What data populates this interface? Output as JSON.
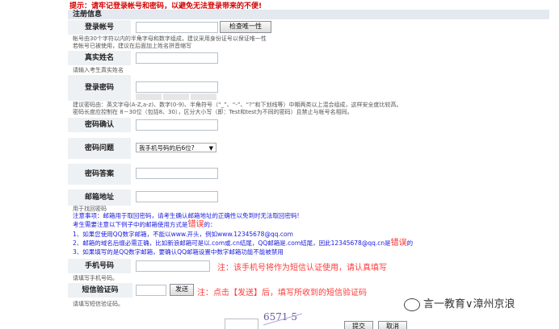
{
  "top_warning": "提示：请牢记登录帐号和密码，以避免无法登录带来的不便!",
  "section_title": "注册信息",
  "fields": {
    "account_label": "登录帐号",
    "check_button": "检查唯一性",
    "account_hint_1": "帐号由30个字符以内的半角字母和数字组成，建议采用身份证号以保证唯一性",
    "account_hint_2": "若帐号已被使用，建议在后面加上姓名拼音缩写",
    "realname_label": "真实姓名",
    "realname_hint": "请输入考生真实姓名",
    "password_label": "登录密码",
    "password_hint_1": "建议密码由：英文字母(A-Z,a-z)、数字(0-9)、半角符号（“_”、“-”、“?”和下划线等）中期两类以上混合组成，这样安全度比较高。",
    "password_hint_2": "密码长度应控制在 8－30位（包括8、30），区分大小写（即：Test和test为不同的密码）且禁止与帐号名相同。",
    "confirm_label": "密码确认",
    "question_label": "密码问题",
    "question_value": "我手机号码的后6位?",
    "answer_label": "密码答案",
    "email_label": "邮箱地址",
    "email_hint": "用于找回密码",
    "phone_label": "手机号码",
    "phone_note": "注：该手机号将作为短信认证使用，请认真填写",
    "phone_hint": "请填写手机号码。",
    "sms_label": "短信验证码",
    "send_button": "发送",
    "sms_note": "注：点击【发送】后，填写所收到的短信验证码",
    "sms_hint": "请填写短信验证码。",
    "submit_button": "提交",
    "cancel_button": "取消",
    "captcha_text": "6571 5"
  },
  "notice": {
    "line1": "注意事项：邮箱用于取回密码，请考生确认邮箱地址的正确性以免到时无法取回密码!",
    "line2_prefix": "考生需要注意以下例子中的邮箱使用方式是",
    "line2_error": "错误",
    "line2_suffix": "的：",
    "line3": "1、如果您使用QQ数字邮箱，不能以www.开头，例如www.12345678@qq.com",
    "line4_a": "2、邮箱的域名后缀必需正确，比如新浪邮箱可是以.com或.cn结尾，QQ邮箱是.com结尾，因此12345678@qq.cn是",
    "line4_error": "错误",
    "line4_b": "的",
    "line5": "3、如果填写的是QQ数字邮箱，要确认QQ邮箱设置中数字邮箱功能不能被禁用"
  },
  "watermark": "言一教育∨漳州京浪"
}
